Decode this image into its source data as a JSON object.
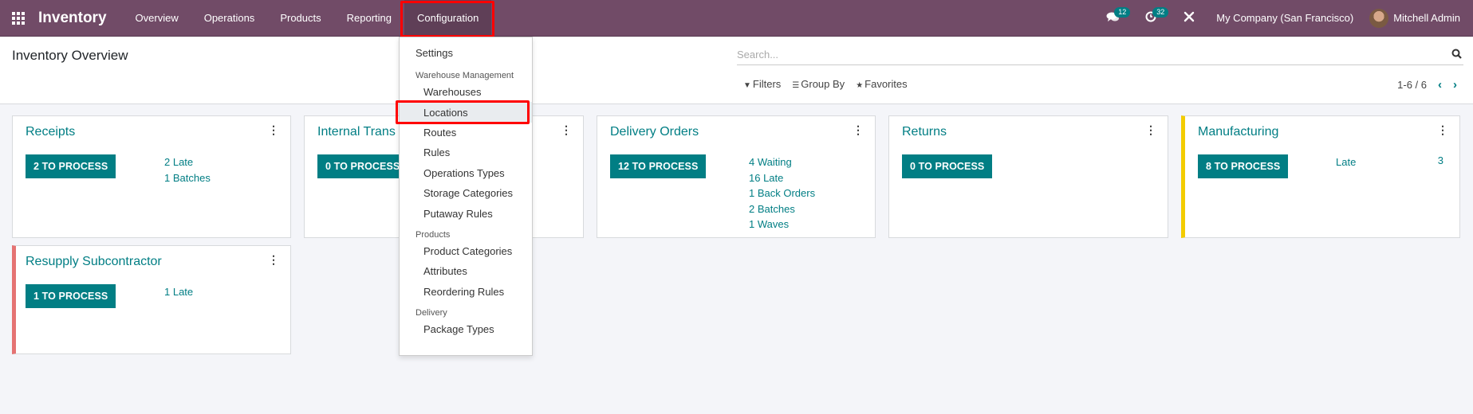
{
  "navbar": {
    "app_name": "Inventory",
    "menu": [
      {
        "label": "Overview"
      },
      {
        "label": "Operations"
      },
      {
        "label": "Products"
      },
      {
        "label": "Reporting"
      },
      {
        "label": "Configuration",
        "active": true
      }
    ],
    "messages_count": "12",
    "activities_count": "32",
    "company": "My Company (San Francisco)",
    "user": "Mitchell Admin"
  },
  "control_panel": {
    "title": "Inventory Overview",
    "search_placeholder": "Search...",
    "filters_label": "Filters",
    "group_by_label": "Group By",
    "favorites_label": "Favorites",
    "pager": "1-6 / 6"
  },
  "config_menu": {
    "settings": "Settings",
    "sections": [
      {
        "header": "Warehouse Management",
        "items": [
          "Warehouses",
          "Locations",
          "Routes",
          "Rules",
          "Operations Types",
          "Storage Categories",
          "Putaway Rules"
        ]
      },
      {
        "header": "Products",
        "items": [
          "Product Categories",
          "Attributes",
          "Reordering Rules"
        ]
      },
      {
        "header": "Delivery",
        "items": [
          "Package Types"
        ]
      }
    ],
    "highlighted_item": "Locations"
  },
  "cards": [
    {
      "title": "Receipts",
      "button": "2 TO PROCESS",
      "stats": [
        "2 Late",
        "1 Batches"
      ]
    },
    {
      "title": "Internal Transfers",
      "title_visible": "Internal Trans",
      "button": "0 TO PROCESS",
      "stats": []
    },
    {
      "title": "Delivery Orders",
      "button": "12 TO PROCESS",
      "stats": [
        "4 Waiting",
        "16 Late",
        "1 Back Orders",
        "2 Batches",
        "1 Waves"
      ]
    },
    {
      "title": "Returns",
      "button": "0 TO PROCESS",
      "stats": []
    },
    {
      "title": "Manufacturing",
      "button": "8 TO PROCESS",
      "stats": [
        "Late"
      ],
      "stat_value": "3",
      "accent": "#f3cc00"
    },
    {
      "title": "Resupply Subcontractor",
      "button": "1 TO PROCESS",
      "stats": [
        "1 Late"
      ],
      "accent": "#e57373"
    }
  ],
  "colors": {
    "navbar": "#714b67",
    "primary": "#017e84",
    "highlight_box": "#ff0000"
  }
}
